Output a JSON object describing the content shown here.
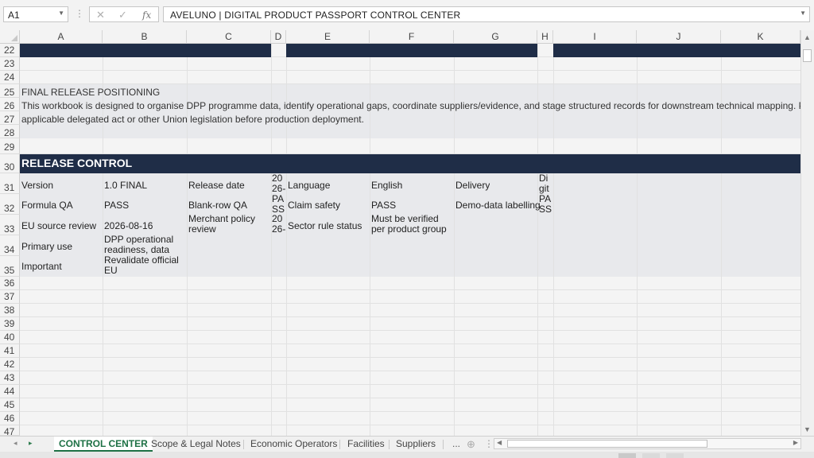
{
  "formula_bar": {
    "name_box": "A1",
    "formula": "AVELUNO | DIGITAL PRODUCT PASSPORT CONTROL CENTER",
    "cancel_icon": "close-icon",
    "confirm_icon": "check-icon",
    "function_label": "fx"
  },
  "columns": [
    "A",
    "B",
    "C",
    "D",
    "E",
    "F",
    "G",
    "H",
    "I",
    "J",
    "K"
  ],
  "rows": [
    "22",
    "23",
    "24",
    "25",
    "26",
    "27",
    "28",
    "29",
    "30",
    "31",
    "32",
    "33",
    "34",
    "35",
    "36",
    "37",
    "38",
    "39",
    "40",
    "41",
    "42",
    "43",
    "44",
    "45",
    "46",
    "47"
  ],
  "colors": {
    "navy": "#1f2d47",
    "active_tab": "#1e7145"
  },
  "sheet": {
    "positioning_title": "FINAL RELEASE POSITIONING",
    "positioning_line1": "This workbook is designed to organise DPP programme data, identify operational gaps, coordinate suppliers/evidence, and stage structured records for downstream technical mapping. Product-group-speci",
    "positioning_line2": "applicable delegated act or other Union legislation before production deployment.",
    "release_title": "RELEASE CONTROL",
    "cells": {
      "a31": "Version",
      "b31": "1.0 FINAL",
      "c31": "Release date",
      "d31": "20 26-",
      "e31": "Language",
      "f31": "English",
      "g31": "Delivery",
      "h31": "Di git",
      "a32": "Formula QA",
      "b32": "PASS",
      "c32": "Blank-row QA",
      "d32": "PA SS",
      "e32": "Claim safety",
      "f32": "PASS",
      "g32": "Demo-data labelling",
      "h32": "PA SS",
      "a33": "EU source review",
      "b33": "2026-08-16",
      "c33": "Merchant policy review",
      "d33": "20 26-",
      "e33": "Sector rule status",
      "f33": "Must be verified per product group",
      "a34": "Primary use",
      "b34": "DPP operational readiness, data",
      "a35": "Important",
      "b35": "Revalidate official EU technical/product-"
    }
  },
  "tabs": [
    "CONTROL CENTER",
    "Scope & Legal Notes",
    "Economic Operators",
    "Facilities",
    "Suppliers"
  ],
  "tabs_more": "...",
  "add_sheet_icon": "plus-circle-icon"
}
